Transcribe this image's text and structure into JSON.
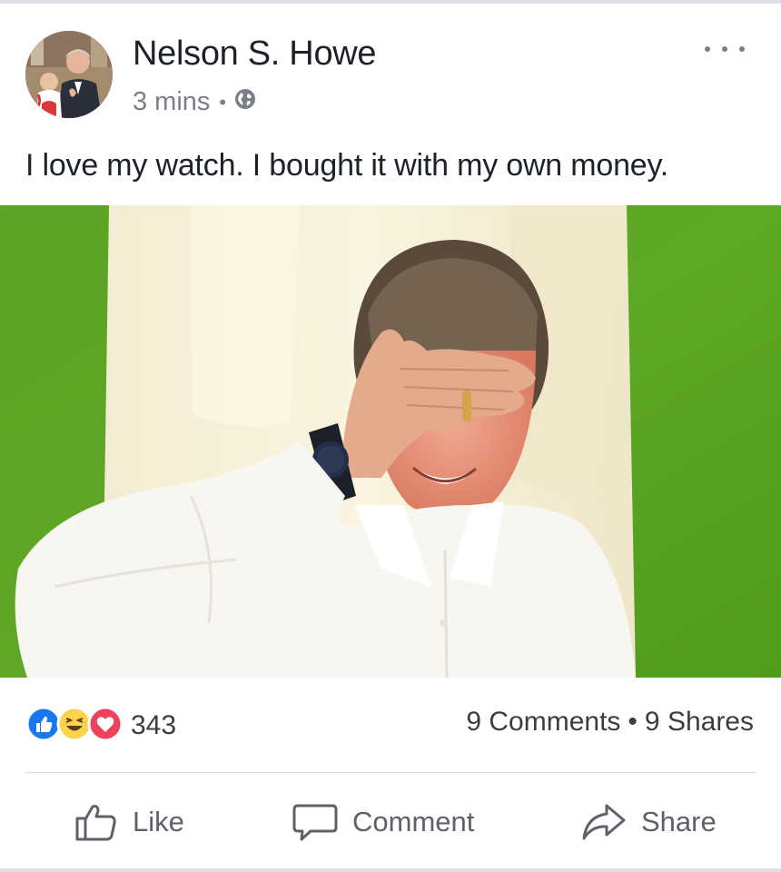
{
  "post": {
    "author_name": "Nelson S. Howe",
    "timestamp": "3 mins",
    "meta_separator": "•",
    "privacy_icon": "globe-icon",
    "more_icon": "more-options-icon",
    "text": "I love my watch. I bought it with my own money."
  },
  "photo": {
    "subject": "man-covering-eyes-photo"
  },
  "reactions": {
    "icons": [
      "like-reaction-icon",
      "haha-reaction-icon",
      "love-reaction-icon"
    ],
    "count": "343",
    "comments": "9 Comments",
    "separator": "•",
    "shares": "9 Shares"
  },
  "actions": {
    "like_label": "Like",
    "comment_label": "Comment",
    "share_label": "Share"
  },
  "colors": {
    "like_blue": "#1877f2",
    "love_red": "#f0405c",
    "haha_yellow": "#fcd34d",
    "text_gray": "#7a7f88"
  }
}
